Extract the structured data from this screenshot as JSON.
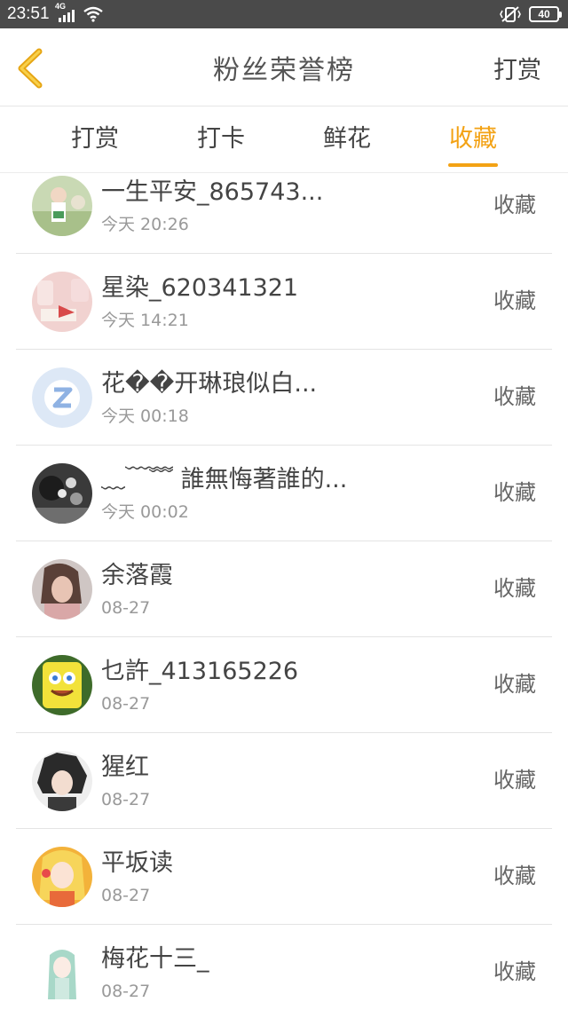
{
  "status_bar": {
    "time": "23:51",
    "network": "4G",
    "battery": "40"
  },
  "header": {
    "title": "粉丝荣誉榜",
    "action_label": "打赏",
    "accent_color": "#f3a214"
  },
  "tabs": [
    {
      "label": "打赏",
      "active": false
    },
    {
      "label": "打卡",
      "active": false
    },
    {
      "label": "鲜花",
      "active": false
    },
    {
      "label": "收藏",
      "active": true
    }
  ],
  "list": [
    {
      "name": "一生平安_865743...",
      "time": "今天 20:26",
      "action": "收藏",
      "avatar": "avatar-photo-girl-icon"
    },
    {
      "name": "星染_620341321",
      "time": "今天 14:21",
      "action": "收藏",
      "avatar": "avatar-pink-cake-icon"
    },
    {
      "name": "花��开琳琅似白...",
      "time": "今天 00:18",
      "action": "收藏",
      "avatar": "avatar-default-z-icon"
    },
    {
      "name": "﹏﹋﹌ 誰無悔著誰的...",
      "time": "今天 00:02",
      "action": "收藏",
      "avatar": "avatar-dark-photo-icon"
    },
    {
      "name": "余落霞",
      "time": "08-27",
      "action": "收藏",
      "avatar": "avatar-portrait-icon"
    },
    {
      "name": "乜許_413165226",
      "time": "08-27",
      "action": "收藏",
      "avatar": "avatar-spongebob-icon"
    },
    {
      "name": "猩红",
      "time": "08-27",
      "action": "收藏",
      "avatar": "avatar-anime-boy-icon"
    },
    {
      "name": "平坂读",
      "time": "08-27",
      "action": "收藏",
      "avatar": "avatar-anime-girl-icon"
    },
    {
      "name": "梅花十三_",
      "time": "08-27",
      "action": "收藏",
      "avatar": "avatar-anime-green-icon"
    }
  ]
}
